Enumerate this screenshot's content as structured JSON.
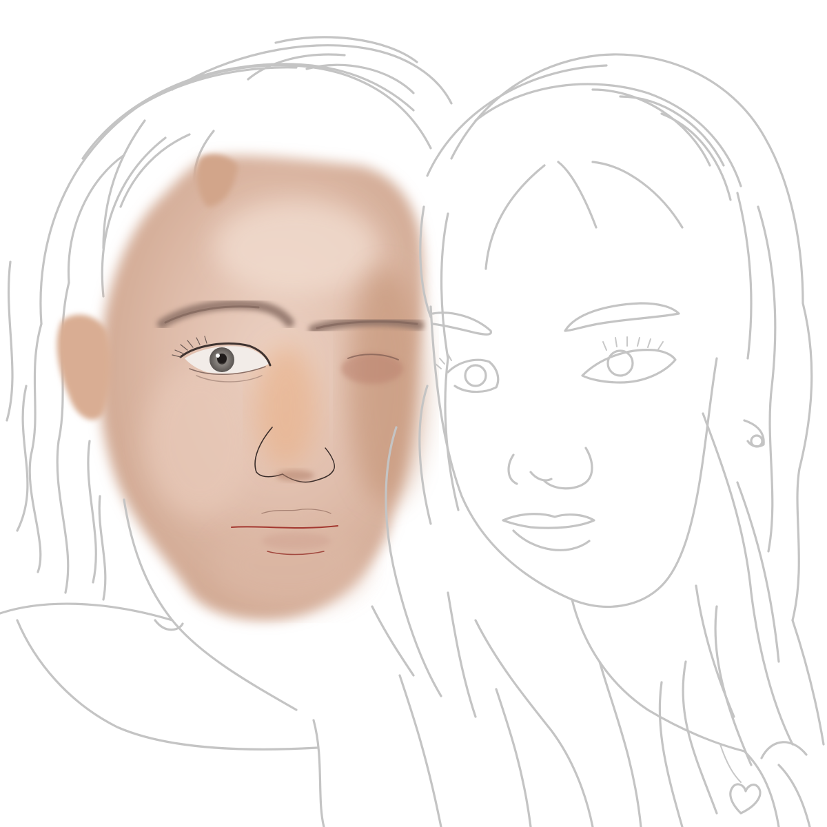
{
  "artwork": {
    "kind": "digital-portrait-sketch",
    "background": "#ffffff",
    "line_color": "#c4c4c4",
    "skin_color": "#d8b3a0",
    "skin_shadow": "#c9997e",
    "skin_highlight": "#f1dccf",
    "brow_color": "#8a6f63",
    "lip_line_color": "#a3372f",
    "iris_color": "#6f6a66"
  }
}
